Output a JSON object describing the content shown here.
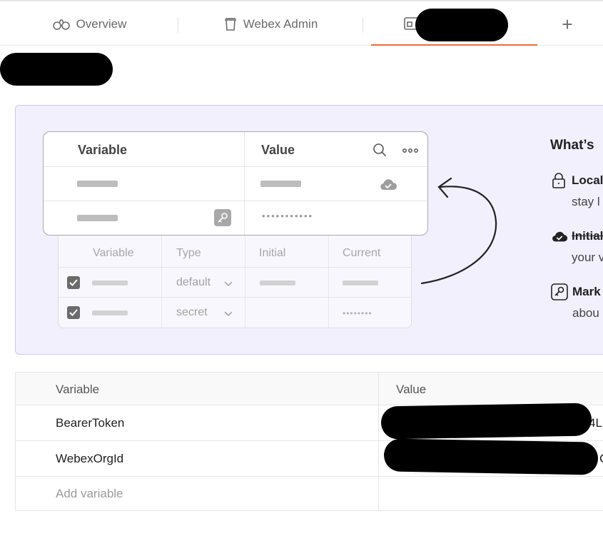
{
  "tabs": [
    {
      "label": "Overview",
      "icon": "binoculars-icon"
    },
    {
      "label": "Webex Admin",
      "icon": "trash-icon"
    },
    {
      "label": "",
      "icon": "environment-icon",
      "active": true
    }
  ],
  "add_tab_symbol": "+",
  "illustration": {
    "front_headers": {
      "variable": "Variable",
      "value": "Value"
    },
    "front_masked": "•••••••••••",
    "back_headers": {
      "variable": "Variable",
      "type": "Type",
      "initial": "Initial",
      "current": "Current"
    },
    "back_rows": [
      {
        "type": "default"
      },
      {
        "type": "secret",
        "masked": "••••••••"
      }
    ]
  },
  "whats_new": {
    "title": "What’s",
    "items": [
      {
        "label": "Local",
        "sub": "stay l",
        "icon": "lock-icon"
      },
      {
        "label": "Initial",
        "sub": "your v",
        "icon": "cloud-check-icon"
      },
      {
        "label": "Mark",
        "sub": "abou",
        "icon": "key-icon"
      }
    ]
  },
  "variables_table": {
    "headers": {
      "variable": "Variable",
      "value": "Value"
    },
    "rows": [
      {
        "name": "BearerToken",
        "value_tail": "4L"
      },
      {
        "name": "WebexOrgId",
        "value_tail": "C"
      }
    ],
    "add_placeholder": "Add variable"
  },
  "colors": {
    "accent": "#f26b3a",
    "hero_bg": "#f3f0fd",
    "hero_border": "#cfc7ef"
  }
}
